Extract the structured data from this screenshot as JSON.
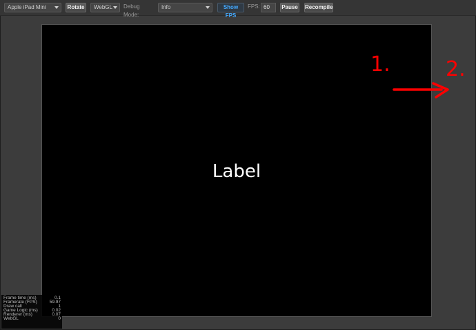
{
  "toolbar": {
    "device": "Apple iPad Mini",
    "rotate_label": "Rotate",
    "renderer": "WebGL",
    "debug_mode_label": "Debug Mode:",
    "debug_mode_value": "Info",
    "show_fps_label": "Show FPS",
    "fps_label": "FPS:",
    "fps_value": "60",
    "pause_label": "Pause",
    "recompile_label": "Recompile"
  },
  "canvas": {
    "label": "Label"
  },
  "stats": [
    {
      "name": "Frame time (ms)",
      "value": "0.1"
    },
    {
      "name": "Framerate (FPS)",
      "value": "59.97"
    },
    {
      "name": "Draw call",
      "value": "1"
    },
    {
      "name": "Game Logic (ms)",
      "value": "0.02"
    },
    {
      "name": "Renderer (ms)",
      "value": "0.07"
    },
    {
      "name": "WebGL",
      "value": "0"
    }
  ],
  "annotation": {
    "mark1": "1.",
    "mark2": "2.",
    "color": "#ff0000",
    "icon": "arrow-right-icon"
  },
  "colors": {
    "accent": "#43a9ff",
    "background": "#3c3c3c",
    "canvas": "#000000"
  }
}
